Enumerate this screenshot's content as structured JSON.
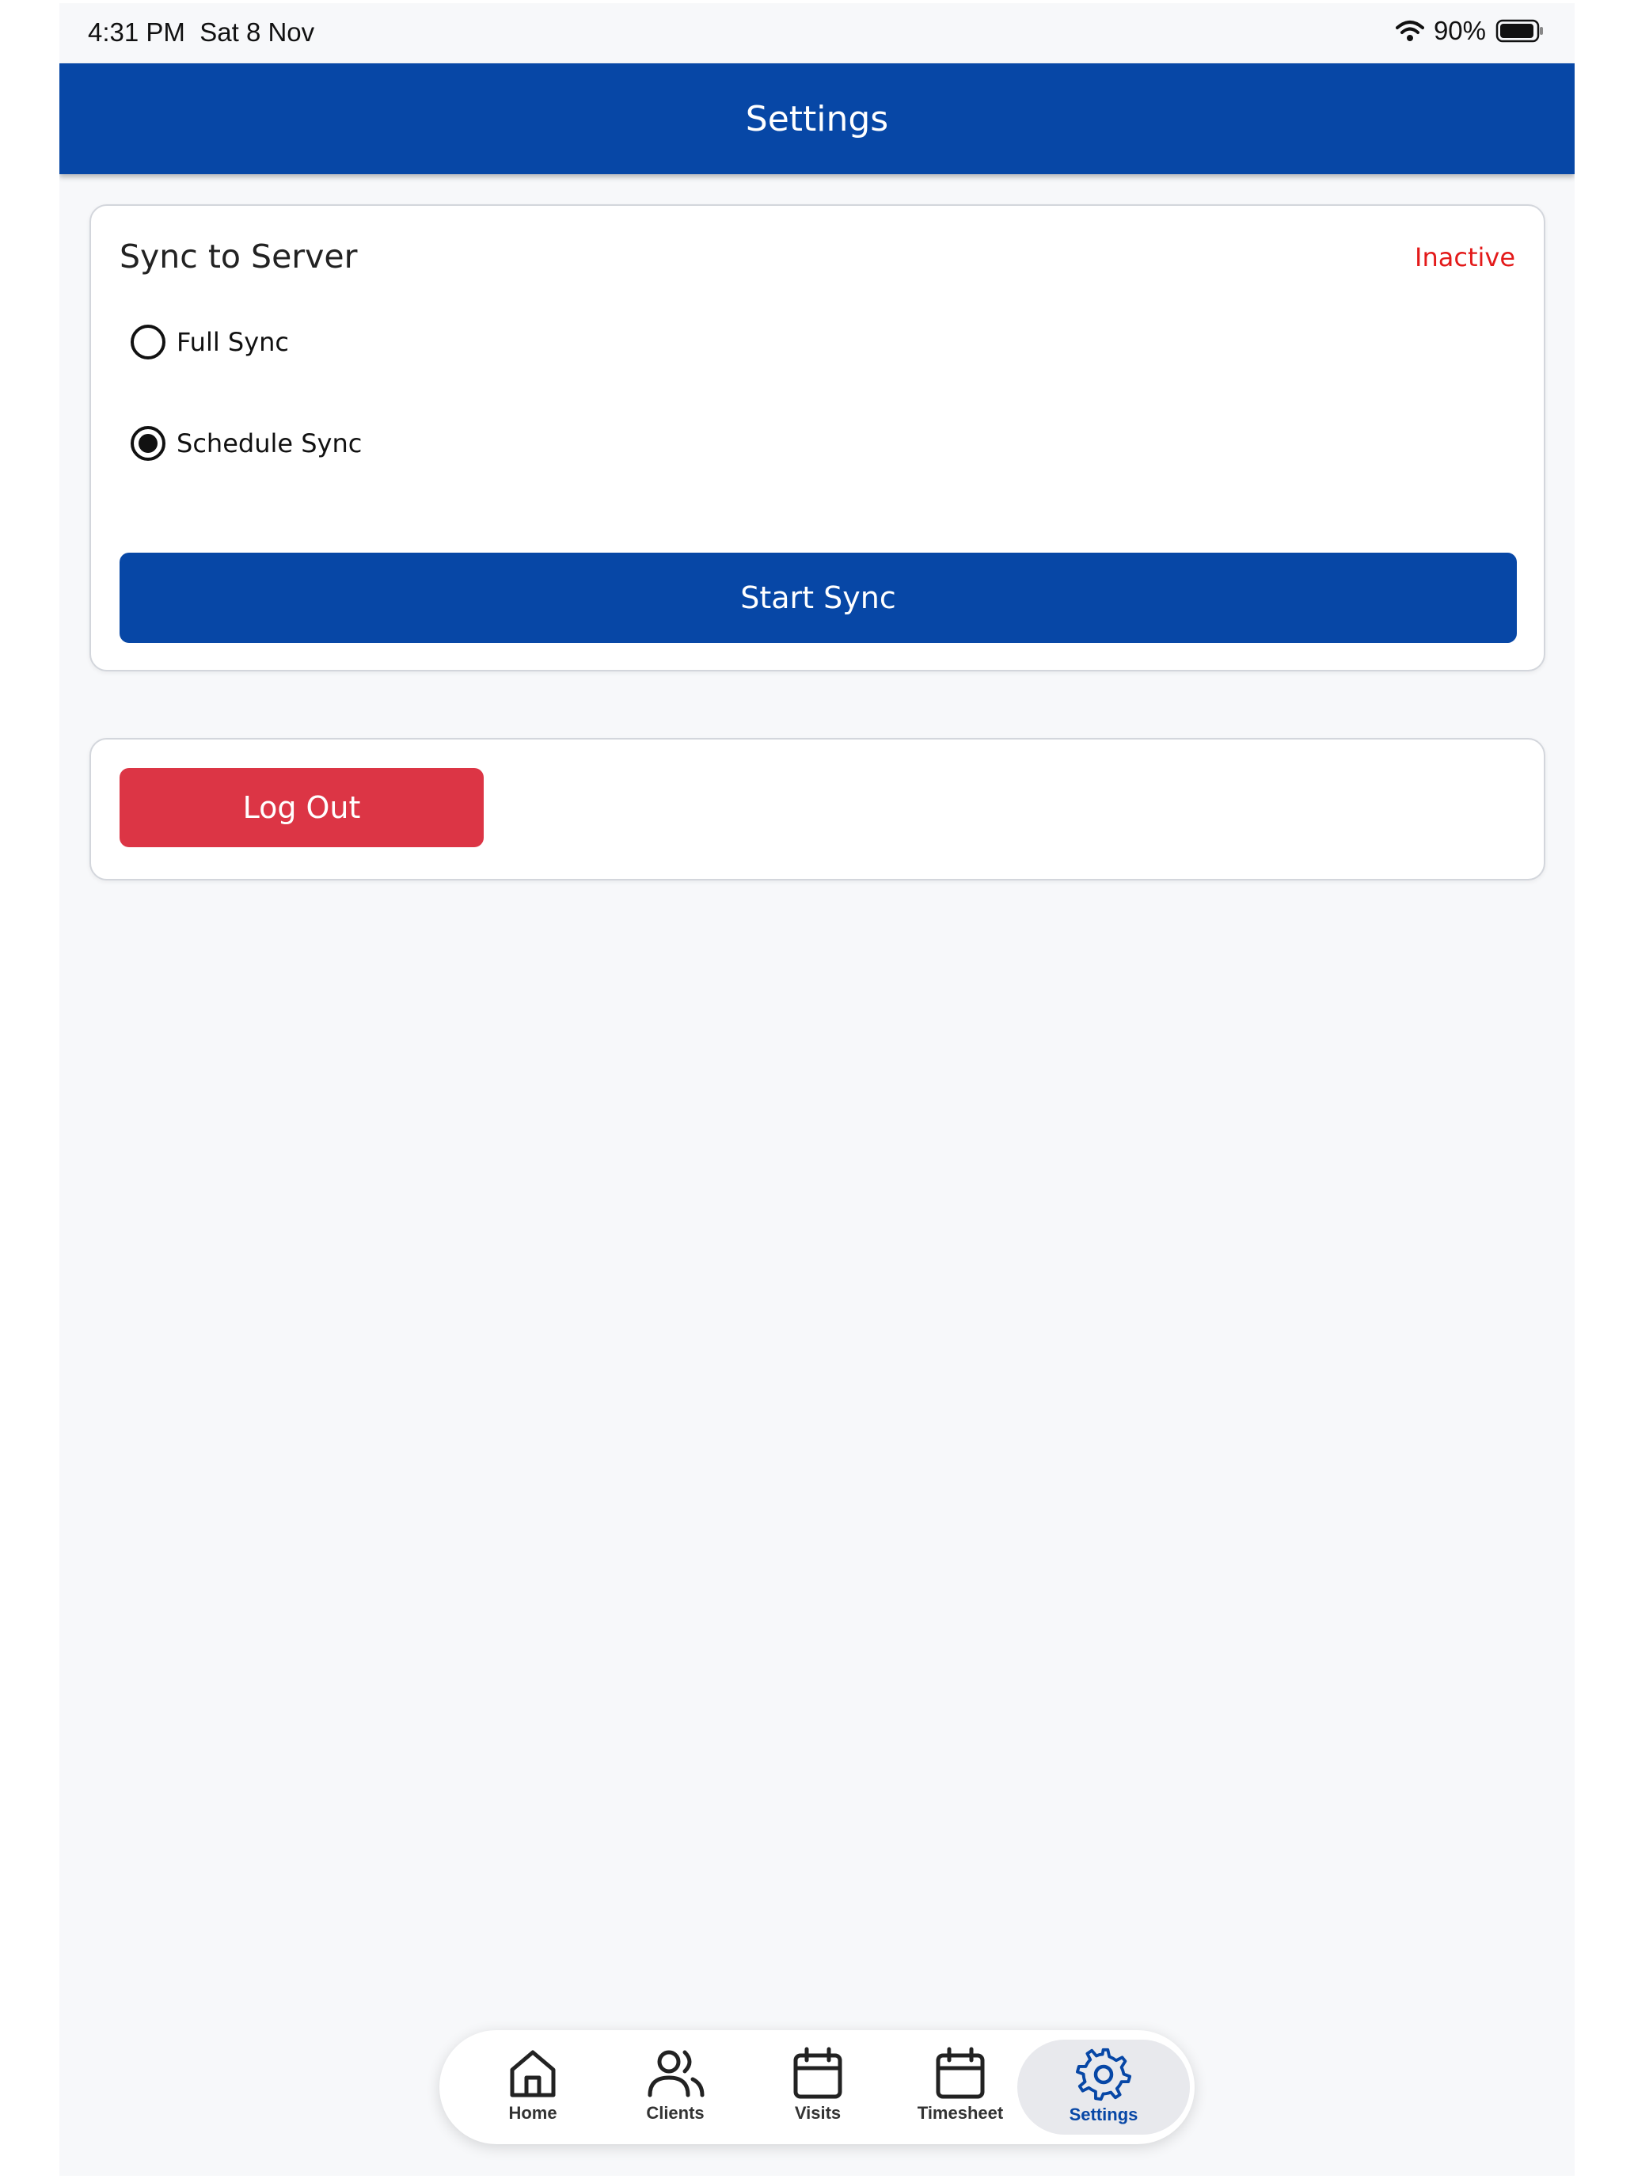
{
  "status_bar": {
    "time": "4:31 PM",
    "date": "Sat 8 Nov",
    "battery": "90%"
  },
  "header": {
    "title": "Settings"
  },
  "sync_card": {
    "title": "Sync to Server",
    "status": "Inactive",
    "status_color": "#e31a1a",
    "options": [
      {
        "label": "Full Sync",
        "selected": false
      },
      {
        "label": "Schedule Sync",
        "selected": true
      }
    ],
    "start_label": "Start Sync"
  },
  "logout_card": {
    "logout_label": "Log Out"
  },
  "tab_bar": {
    "tabs": [
      {
        "label": "Home",
        "icon": "home-icon"
      },
      {
        "label": "Clients",
        "icon": "users-icon"
      },
      {
        "label": "Visits",
        "icon": "calendar-icon"
      },
      {
        "label": "Timesheet",
        "icon": "calendar-icon"
      },
      {
        "label": "Settings",
        "icon": "gear-icon",
        "active": true
      }
    ]
  },
  "colors": {
    "brand": "#0747a6",
    "danger": "#dc3545"
  }
}
